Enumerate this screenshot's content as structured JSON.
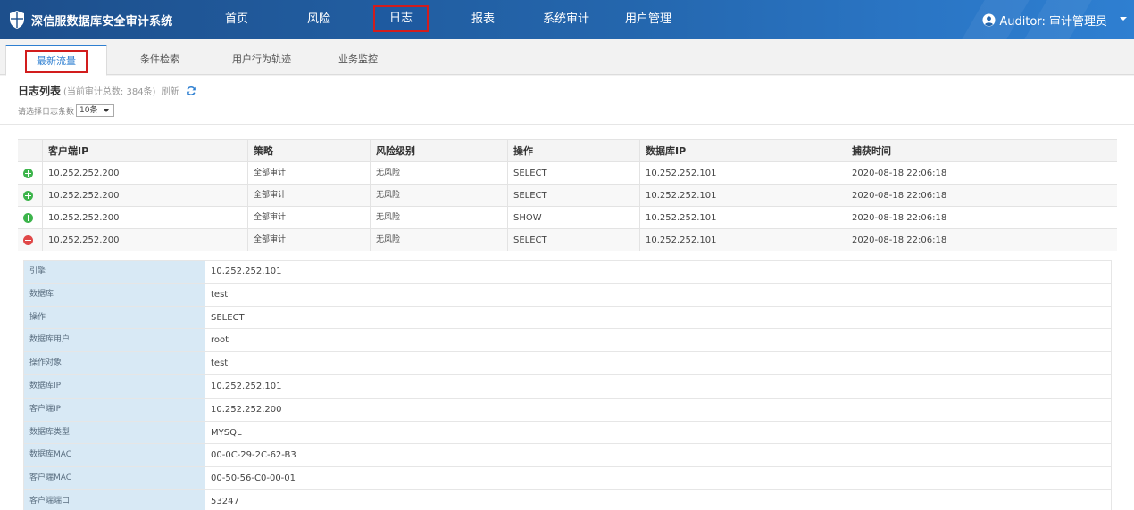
{
  "app": {
    "title": "深信服数据库安全审计系统",
    "nav": [
      {
        "label": "首页"
      },
      {
        "label": "风险"
      },
      {
        "label": "日志"
      },
      {
        "label": "报表"
      },
      {
        "label": "系统审计"
      },
      {
        "label": "用户管理"
      }
    ],
    "active_nav": "日志",
    "user_label": "Auditor: 审计管理员"
  },
  "tabs": [
    {
      "label": "最新流量"
    },
    {
      "label": "条件检索"
    },
    {
      "label": "用户行为轨迹"
    },
    {
      "label": "业务监控"
    }
  ],
  "active_tab": "最新流量",
  "list": {
    "title": "日志列表",
    "total_text": "(当前审计总数: 384条)",
    "refresh_label": "刷新",
    "count_label": "请选择日志条数",
    "count_value": "10条"
  },
  "table": {
    "columns": [
      "客户端IP",
      "策略",
      "风险级别",
      "操作",
      "数据库IP",
      "捕获时间"
    ],
    "rows": [
      {
        "state": "collapsed",
        "client_ip": "10.252.252.200",
        "policy": "全部审计",
        "risk": "无风险",
        "operation": "SELECT",
        "db_ip": "10.252.252.101",
        "time": "2020-08-18 22:06:18"
      },
      {
        "state": "collapsed",
        "client_ip": "10.252.252.200",
        "policy": "全部审计",
        "risk": "无风险",
        "operation": "SELECT",
        "db_ip": "10.252.252.101",
        "time": "2020-08-18 22:06:18"
      },
      {
        "state": "collapsed",
        "client_ip": "10.252.252.200",
        "policy": "全部审计",
        "risk": "无风险",
        "operation": "SHOW",
        "db_ip": "10.252.252.101",
        "time": "2020-08-18 22:06:18"
      },
      {
        "state": "expanded",
        "client_ip": "10.252.252.200",
        "policy": "全部审计",
        "risk": "无风险",
        "operation": "SELECT",
        "db_ip": "10.252.252.101",
        "time": "2020-08-18 22:06:18"
      }
    ]
  },
  "detail": [
    {
      "key": "引擎",
      "value": "10.252.252.101"
    },
    {
      "key": "数据库",
      "value": "test"
    },
    {
      "key": "操作",
      "value": "SELECT"
    },
    {
      "key": "数据库用户",
      "value": "root"
    },
    {
      "key": "操作对象",
      "value": "test"
    },
    {
      "key": "数据库IP",
      "value": "10.252.252.101"
    },
    {
      "key": "客户端IP",
      "value": "10.252.252.200"
    },
    {
      "key": "数据库类型",
      "value": "MYSQL"
    },
    {
      "key": "数据库MAC",
      "value": "00-0C-29-2C-62-B3"
    },
    {
      "key": "客户端MAC",
      "value": "00-50-56-C0-00-01"
    },
    {
      "key": "客户端端口",
      "value": "53247"
    }
  ],
  "icons": {
    "logo": "shield-logo-icon",
    "user": "user-circle-icon",
    "refresh": "refresh-icon",
    "expand": "plus-circle-icon",
    "collapse": "minus-circle-icon"
  },
  "colors": {
    "nav_bg": "#2466ad",
    "accent": "#2e7fd1",
    "highlight_border": "#d21d1d",
    "expand_green": "#3cb44b",
    "collapse_red": "#e04848",
    "detail_key_bg": "#d8e9f5"
  }
}
